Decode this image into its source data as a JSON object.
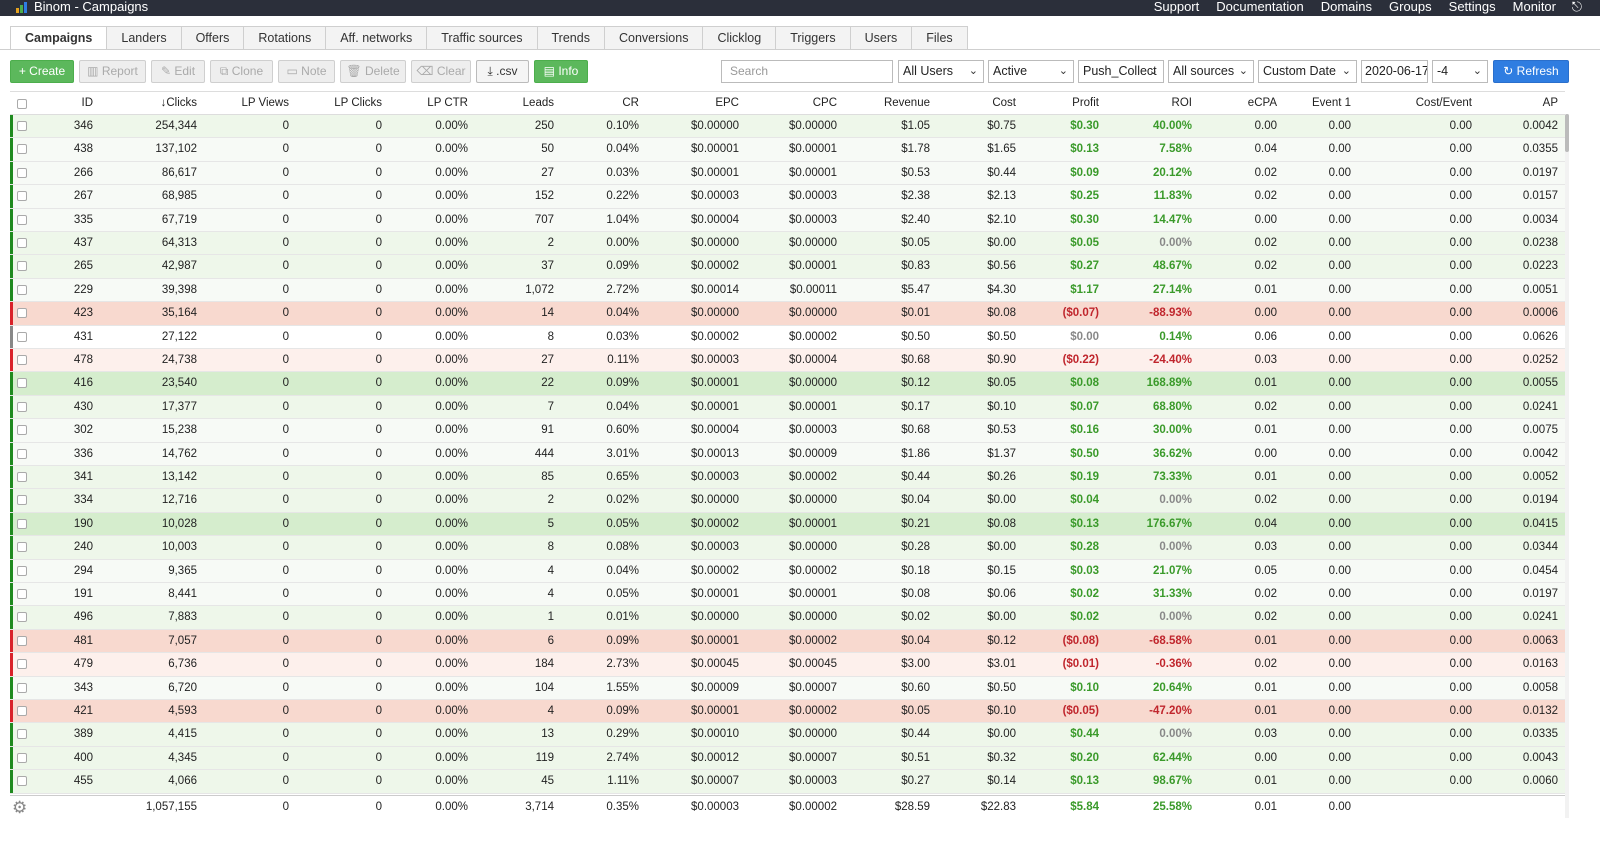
{
  "app": {
    "title": "Binom - Campaigns",
    "logo_colors": [
      "#e5a21f",
      "#4cae4c",
      "#2f7de1"
    ]
  },
  "topnav": {
    "items": [
      "Support",
      "Documentation",
      "Domains",
      "Groups",
      "Settings",
      "Monitor"
    ],
    "logout_icon": "logout-icon"
  },
  "tabs": [
    "Campaigns",
    "Landers",
    "Offers",
    "Rotations",
    "Aff. networks",
    "Traffic sources",
    "Trends",
    "Conversions",
    "Clicklog",
    "Triggers",
    "Users",
    "Files"
  ],
  "active_tab": "Campaigns",
  "toolbar": {
    "create": "+ Create",
    "report": "Report",
    "edit": "Edit",
    "clone": "Clone",
    "note": "Note",
    "delete": "Delete",
    "clear": "Clear",
    "csv": ".csv",
    "info": "Info",
    "search_placeholder": "Search",
    "users": "All Users",
    "status": "Active",
    "group": "Push_Collect",
    "sources": "All sources",
    "date_mode": "Custom Date",
    "date": "2020-06-17",
    "tz": "-4",
    "refresh": "Refresh"
  },
  "columns": [
    "ID",
    "Clicks",
    "LP Views",
    "LP Clicks",
    "LP CTR",
    "Leads",
    "CR",
    "EPC",
    "CPC",
    "Revenue",
    "Cost",
    "Profit",
    "ROI",
    "eCPA",
    "Event 1",
    "Cost/Event",
    "AP"
  ],
  "sort_indicator": "↓",
  "colors": {
    "pos_row": "#eef7ea",
    "pos_row_strong": "#d5edcd",
    "neg_row": "#f8d9cf",
    "neg_row_light": "#fdf0ec",
    "neutral_row": "#f7faf6",
    "green_bar": "#1f8a1f",
    "red_bar": "#d9222a"
  },
  "rows": [
    {
      "id": "346",
      "clicks": "254,344",
      "lpv": "0",
      "lpc": "0",
      "lpctr": "0.00%",
      "leads": "250",
      "cr": "0.10%",
      "epc": "$0.00000",
      "cpc": "$0.00000",
      "rev": "$1.05",
      "cost": "$0.75",
      "profit": "$0.30",
      "roi": "40.00%",
      "ecpa": "0.00",
      "ev1": "0.00",
      "cpe": "0.00",
      "ap": "0.0042",
      "tone": "pos"
    },
    {
      "id": "438",
      "clicks": "137,102",
      "lpv": "0",
      "lpc": "0",
      "lpctr": "0.00%",
      "leads": "50",
      "cr": "0.04%",
      "epc": "$0.00001",
      "cpc": "$0.00001",
      "rev": "$1.78",
      "cost": "$1.65",
      "profit": "$0.13",
      "roi": "7.58%",
      "ecpa": "0.04",
      "ev1": "0.00",
      "cpe": "0.00",
      "ap": "0.0355",
      "tone": "light"
    },
    {
      "id": "266",
      "clicks": "86,617",
      "lpv": "0",
      "lpc": "0",
      "lpctr": "0.00%",
      "leads": "27",
      "cr": "0.03%",
      "epc": "$0.00001",
      "cpc": "$0.00001",
      "rev": "$0.53",
      "cost": "$0.44",
      "profit": "$0.09",
      "roi": "20.12%",
      "ecpa": "0.02",
      "ev1": "0.00",
      "cpe": "0.00",
      "ap": "0.0197",
      "tone": "light"
    },
    {
      "id": "267",
      "clicks": "68,985",
      "lpv": "0",
      "lpc": "0",
      "lpctr": "0.00%",
      "leads": "152",
      "cr": "0.22%",
      "epc": "$0.00003",
      "cpc": "$0.00003",
      "rev": "$2.38",
      "cost": "$2.13",
      "profit": "$0.25",
      "roi": "11.83%",
      "ecpa": "0.02",
      "ev1": "0.00",
      "cpe": "0.00",
      "ap": "0.0157",
      "tone": "light"
    },
    {
      "id": "335",
      "clicks": "67,719",
      "lpv": "0",
      "lpc": "0",
      "lpctr": "0.00%",
      "leads": "707",
      "cr": "1.04%",
      "epc": "$0.00004",
      "cpc": "$0.00003",
      "rev": "$2.40",
      "cost": "$2.10",
      "profit": "$0.30",
      "roi": "14.47%",
      "ecpa": "0.00",
      "ev1": "0.00",
      "cpe": "0.00",
      "ap": "0.0034",
      "tone": "light"
    },
    {
      "id": "437",
      "clicks": "64,313",
      "lpv": "0",
      "lpc": "0",
      "lpctr": "0.00%",
      "leads": "2",
      "cr": "0.00%",
      "epc": "$0.00000",
      "cpc": "$0.00000",
      "rev": "$0.05",
      "cost": "$0.00",
      "profit": "$0.05",
      "roi": "0.00%",
      "ecpa": "0.02",
      "ev1": "0.00",
      "cpe": "0.00",
      "ap": "0.0238",
      "tone": "pos"
    },
    {
      "id": "265",
      "clicks": "42,987",
      "lpv": "0",
      "lpc": "0",
      "lpctr": "0.00%",
      "leads": "37",
      "cr": "0.09%",
      "epc": "$0.00002",
      "cpc": "$0.00001",
      "rev": "$0.83",
      "cost": "$0.56",
      "profit": "$0.27",
      "roi": "48.67%",
      "ecpa": "0.02",
      "ev1": "0.00",
      "cpe": "0.00",
      "ap": "0.0223",
      "tone": "pos"
    },
    {
      "id": "229",
      "clicks": "39,398",
      "lpv": "0",
      "lpc": "0",
      "lpctr": "0.00%",
      "leads": "1,072",
      "cr": "2.72%",
      "epc": "$0.00014",
      "cpc": "$0.00011",
      "rev": "$5.47",
      "cost": "$4.30",
      "profit": "$1.17",
      "roi": "27.14%",
      "ecpa": "0.01",
      "ev1": "0.00",
      "cpe": "0.00",
      "ap": "0.0051",
      "tone": "light"
    },
    {
      "id": "423",
      "clicks": "35,164",
      "lpv": "0",
      "lpc": "0",
      "lpctr": "0.00%",
      "leads": "14",
      "cr": "0.04%",
      "epc": "$0.00000",
      "cpc": "$0.00000",
      "rev": "$0.01",
      "cost": "$0.08",
      "profit": "($0.07)",
      "roi": "-88.93%",
      "ecpa": "0.00",
      "ev1": "0.00",
      "cpe": "0.00",
      "ap": "0.0006",
      "tone": "neg"
    },
    {
      "id": "431",
      "clicks": "27,122",
      "lpv": "0",
      "lpc": "0",
      "lpctr": "0.00%",
      "leads": "8",
      "cr": "0.03%",
      "epc": "$0.00002",
      "cpc": "$0.00002",
      "rev": "$0.50",
      "cost": "$0.50",
      "profit": "$0.00",
      "roi": "0.14%",
      "ecpa": "0.06",
      "ev1": "0.00",
      "cpe": "0.00",
      "ap": "0.0626",
      "tone": "white"
    },
    {
      "id": "478",
      "clicks": "24,738",
      "lpv": "0",
      "lpc": "0",
      "lpctr": "0.00%",
      "leads": "27",
      "cr": "0.11%",
      "epc": "$0.00003",
      "cpc": "$0.00004",
      "rev": "$0.68",
      "cost": "$0.90",
      "profit": "($0.22)",
      "roi": "-24.40%",
      "ecpa": "0.03",
      "ev1": "0.00",
      "cpe": "0.00",
      "ap": "0.0252",
      "tone": "neglight"
    },
    {
      "id": "416",
      "clicks": "23,540",
      "lpv": "0",
      "lpc": "0",
      "lpctr": "0.00%",
      "leads": "22",
      "cr": "0.09%",
      "epc": "$0.00001",
      "cpc": "$0.00000",
      "rev": "$0.12",
      "cost": "$0.05",
      "profit": "$0.08",
      "roi": "168.89%",
      "ecpa": "0.01",
      "ev1": "0.00",
      "cpe": "0.00",
      "ap": "0.0055",
      "tone": "strong"
    },
    {
      "id": "430",
      "clicks": "17,377",
      "lpv": "0",
      "lpc": "0",
      "lpctr": "0.00%",
      "leads": "7",
      "cr": "0.04%",
      "epc": "$0.00001",
      "cpc": "$0.00001",
      "rev": "$0.17",
      "cost": "$0.10",
      "profit": "$0.07",
      "roi": "68.80%",
      "ecpa": "0.02",
      "ev1": "0.00",
      "cpe": "0.00",
      "ap": "0.0241",
      "tone": "pos"
    },
    {
      "id": "302",
      "clicks": "15,238",
      "lpv": "0",
      "lpc": "0",
      "lpctr": "0.00%",
      "leads": "91",
      "cr": "0.60%",
      "epc": "$0.00004",
      "cpc": "$0.00003",
      "rev": "$0.68",
      "cost": "$0.53",
      "profit": "$0.16",
      "roi": "30.00%",
      "ecpa": "0.01",
      "ev1": "0.00",
      "cpe": "0.00",
      "ap": "0.0075",
      "tone": "light"
    },
    {
      "id": "336",
      "clicks": "14,762",
      "lpv": "0",
      "lpc": "0",
      "lpctr": "0.00%",
      "leads": "444",
      "cr": "3.01%",
      "epc": "$0.00013",
      "cpc": "$0.00009",
      "rev": "$1.86",
      "cost": "$1.37",
      "profit": "$0.50",
      "roi": "36.62%",
      "ecpa": "0.00",
      "ev1": "0.00",
      "cpe": "0.00",
      "ap": "0.0042",
      "tone": "light"
    },
    {
      "id": "341",
      "clicks": "13,142",
      "lpv": "0",
      "lpc": "0",
      "lpctr": "0.00%",
      "leads": "85",
      "cr": "0.65%",
      "epc": "$0.00003",
      "cpc": "$0.00002",
      "rev": "$0.44",
      "cost": "$0.26",
      "profit": "$0.19",
      "roi": "73.33%",
      "ecpa": "0.01",
      "ev1": "0.00",
      "cpe": "0.00",
      "ap": "0.0052",
      "tone": "pos"
    },
    {
      "id": "334",
      "clicks": "12,716",
      "lpv": "0",
      "lpc": "0",
      "lpctr": "0.00%",
      "leads": "2",
      "cr": "0.02%",
      "epc": "$0.00000",
      "cpc": "$0.00000",
      "rev": "$0.04",
      "cost": "$0.00",
      "profit": "$0.04",
      "roi": "0.00%",
      "ecpa": "0.02",
      "ev1": "0.00",
      "cpe": "0.00",
      "ap": "0.0194",
      "tone": "pos"
    },
    {
      "id": "190",
      "clicks": "10,028",
      "lpv": "0",
      "lpc": "0",
      "lpctr": "0.00%",
      "leads": "5",
      "cr": "0.05%",
      "epc": "$0.00002",
      "cpc": "$0.00001",
      "rev": "$0.21",
      "cost": "$0.08",
      "profit": "$0.13",
      "roi": "176.67%",
      "ecpa": "0.04",
      "ev1": "0.00",
      "cpe": "0.00",
      "ap": "0.0415",
      "tone": "strong"
    },
    {
      "id": "240",
      "clicks": "10,003",
      "lpv": "0",
      "lpc": "0",
      "lpctr": "0.00%",
      "leads": "8",
      "cr": "0.08%",
      "epc": "$0.00003",
      "cpc": "$0.00000",
      "rev": "$0.28",
      "cost": "$0.00",
      "profit": "$0.28",
      "roi": "0.00%",
      "ecpa": "0.03",
      "ev1": "0.00",
      "cpe": "0.00",
      "ap": "0.0344",
      "tone": "pos"
    },
    {
      "id": "294",
      "clicks": "9,365",
      "lpv": "0",
      "lpc": "0",
      "lpctr": "0.00%",
      "leads": "4",
      "cr": "0.04%",
      "epc": "$0.00002",
      "cpc": "$0.00002",
      "rev": "$0.18",
      "cost": "$0.15",
      "profit": "$0.03",
      "roi": "21.07%",
      "ecpa": "0.05",
      "ev1": "0.00",
      "cpe": "0.00",
      "ap": "0.0454",
      "tone": "light"
    },
    {
      "id": "191",
      "clicks": "8,441",
      "lpv": "0",
      "lpc": "0",
      "lpctr": "0.00%",
      "leads": "4",
      "cr": "0.05%",
      "epc": "$0.00001",
      "cpc": "$0.00001",
      "rev": "$0.08",
      "cost": "$0.06",
      "profit": "$0.02",
      "roi": "31.33%",
      "ecpa": "0.02",
      "ev1": "0.00",
      "cpe": "0.00",
      "ap": "0.0197",
      "tone": "light"
    },
    {
      "id": "496",
      "clicks": "7,883",
      "lpv": "0",
      "lpc": "0",
      "lpctr": "0.00%",
      "leads": "1",
      "cr": "0.01%",
      "epc": "$0.00000",
      "cpc": "$0.00000",
      "rev": "$0.02",
      "cost": "$0.00",
      "profit": "$0.02",
      "roi": "0.00%",
      "ecpa": "0.02",
      "ev1": "0.00",
      "cpe": "0.00",
      "ap": "0.0241",
      "tone": "pos"
    },
    {
      "id": "481",
      "clicks": "7,057",
      "lpv": "0",
      "lpc": "0",
      "lpctr": "0.00%",
      "leads": "6",
      "cr": "0.09%",
      "epc": "$0.00001",
      "cpc": "$0.00002",
      "rev": "$0.04",
      "cost": "$0.12",
      "profit": "($0.08)",
      "roi": "-68.58%",
      "ecpa": "0.01",
      "ev1": "0.00",
      "cpe": "0.00",
      "ap": "0.0063",
      "tone": "neg"
    },
    {
      "id": "479",
      "clicks": "6,736",
      "lpv": "0",
      "lpc": "0",
      "lpctr": "0.00%",
      "leads": "184",
      "cr": "2.73%",
      "epc": "$0.00045",
      "cpc": "$0.00045",
      "rev": "$3.00",
      "cost": "$3.01",
      "profit": "($0.01)",
      "roi": "-0.36%",
      "ecpa": "0.02",
      "ev1": "0.00",
      "cpe": "0.00",
      "ap": "0.0163",
      "tone": "neglight"
    },
    {
      "id": "343",
      "clicks": "6,720",
      "lpv": "0",
      "lpc": "0",
      "lpctr": "0.00%",
      "leads": "104",
      "cr": "1.55%",
      "epc": "$0.00009",
      "cpc": "$0.00007",
      "rev": "$0.60",
      "cost": "$0.50",
      "profit": "$0.10",
      "roi": "20.64%",
      "ecpa": "0.01",
      "ev1": "0.00",
      "cpe": "0.00",
      "ap": "0.0058",
      "tone": "light"
    },
    {
      "id": "421",
      "clicks": "4,593",
      "lpv": "0",
      "lpc": "0",
      "lpctr": "0.00%",
      "leads": "4",
      "cr": "0.09%",
      "epc": "$0.00001",
      "cpc": "$0.00002",
      "rev": "$0.05",
      "cost": "$0.10",
      "profit": "($0.05)",
      "roi": "-47.20%",
      "ecpa": "0.01",
      "ev1": "0.00",
      "cpe": "0.00",
      "ap": "0.0132",
      "tone": "neg"
    },
    {
      "id": "389",
      "clicks": "4,415",
      "lpv": "0",
      "lpc": "0",
      "lpctr": "0.00%",
      "leads": "13",
      "cr": "0.29%",
      "epc": "$0.00010",
      "cpc": "$0.00000",
      "rev": "$0.44",
      "cost": "$0.00",
      "profit": "$0.44",
      "roi": "0.00%",
      "ecpa": "0.03",
      "ev1": "0.00",
      "cpe": "0.00",
      "ap": "0.0335",
      "tone": "pos"
    },
    {
      "id": "400",
      "clicks": "4,345",
      "lpv": "0",
      "lpc": "0",
      "lpctr": "0.00%",
      "leads": "119",
      "cr": "2.74%",
      "epc": "$0.00012",
      "cpc": "$0.00007",
      "rev": "$0.51",
      "cost": "$0.32",
      "profit": "$0.20",
      "roi": "62.44%",
      "ecpa": "0.00",
      "ev1": "0.00",
      "cpe": "0.00",
      "ap": "0.0043",
      "tone": "pos"
    },
    {
      "id": "455",
      "clicks": "4,066",
      "lpv": "0",
      "lpc": "0",
      "lpctr": "0.00%",
      "leads": "45",
      "cr": "1.11%",
      "epc": "$0.00007",
      "cpc": "$0.00003",
      "rev": "$0.27",
      "cost": "$0.14",
      "profit": "$0.13",
      "roi": "98.67%",
      "ecpa": "0.01",
      "ev1": "0.00",
      "cpe": "0.00",
      "ap": "0.0060",
      "tone": "pos"
    }
  ],
  "totals": {
    "clicks": "1,057,155",
    "lpv": "0",
    "lpc": "0",
    "lpctr": "0.00%",
    "leads": "3,714",
    "cr": "0.35%",
    "epc": "$0.00003",
    "cpc": "$0.00002",
    "rev": "$28.59",
    "cost": "$22.83",
    "profit": "$5.84",
    "roi": "25.58%",
    "ecpa": "0.01",
    "ev1": "0.00",
    "cpe": ""
  }
}
